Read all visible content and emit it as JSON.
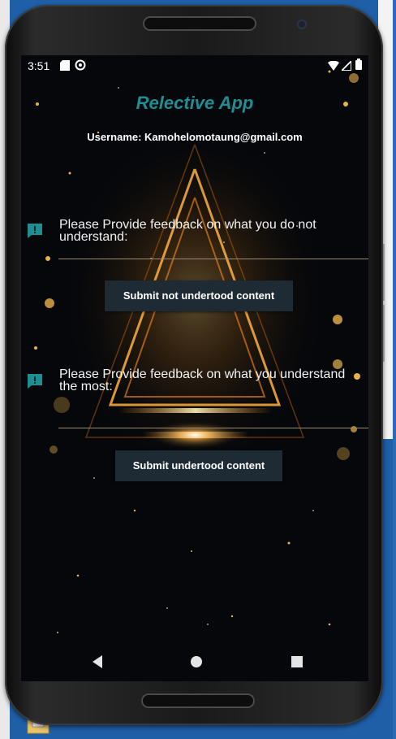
{
  "status_bar": {
    "time": "3:51"
  },
  "app": {
    "title": "Relective App",
    "username": "Username: Kamohelomotaung@gmail.com"
  },
  "feedback_not_understood": {
    "prompt": "Please Provide feedback on what you do not understand:",
    "value": "",
    "button_label": "Submit not undertood content"
  },
  "feedback_understood": {
    "prompt": "Please Provide feedback on what you understand the most:",
    "value": "",
    "button_label": "Submit undertood content"
  },
  "nav_bar": {
    "back": "back-icon",
    "home": "home-icon",
    "recents": "recents-icon"
  },
  "colors": {
    "title": "#1f8e92",
    "button_bg": "#1e2b34",
    "icon_accent": "#1f8e92",
    "background": "#05070b"
  }
}
